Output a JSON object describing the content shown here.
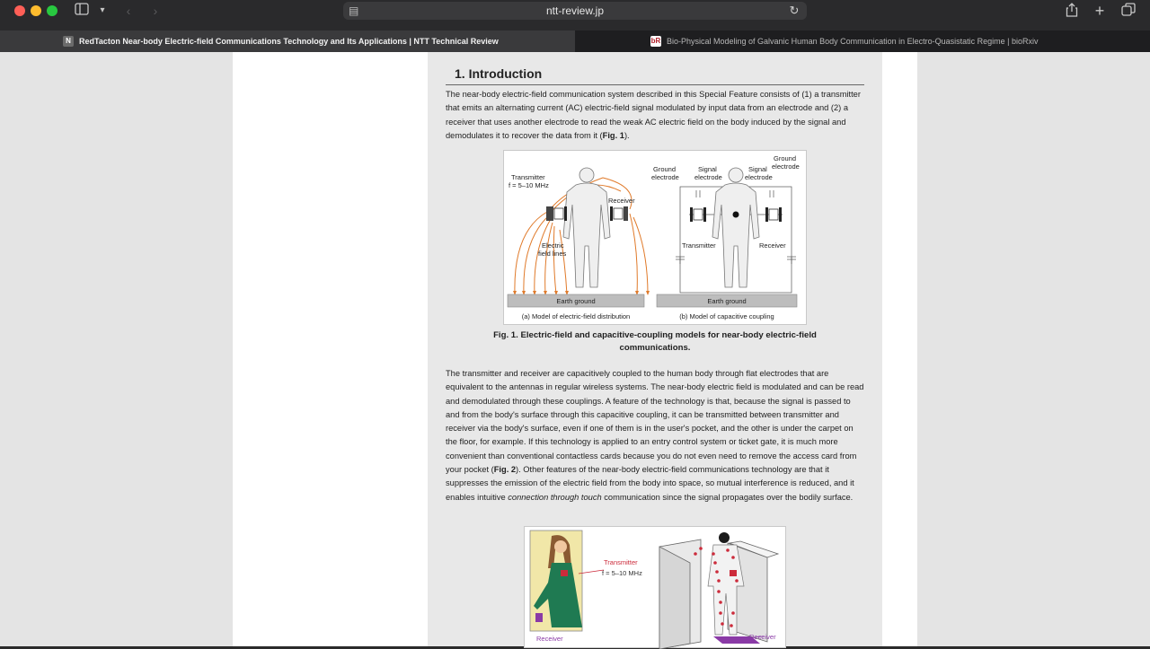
{
  "browser": {
    "address": "ntt-review.jp",
    "tabs": [
      {
        "favicon": "N",
        "title": "RedTacton Near-body Electric-field Communications Technology and Its Applications | NTT Technical Review",
        "active": true
      },
      {
        "favicon": "bR",
        "title": "Bio-Physical Modeling of Galvanic Human Body Communication in Electro-Quasistatic Regime | bioRxiv",
        "active": false
      }
    ],
    "icons": {
      "sidebar": "sidebar-icon",
      "back": "chevron-left-icon",
      "forward": "chevron-right-icon",
      "reload": "reload-icon",
      "share": "share-icon",
      "new_tab": "plus-icon",
      "tab_overview": "tab-overview-icon"
    }
  },
  "article": {
    "section_title": "1. Introduction",
    "para1": [
      {
        "t": "The near-body electric-field communication system described in this Special Feature consists of (1) a transmitter that emits an alternating current (AC) electric-field signal modulated by input data from an electrode and (2) a receiver that uses another electrode to read the weak AC electric field on the body induced by the signal and demodulates it to recover the data from it ("
      },
      {
        "t": "Fig. 1",
        "b": true
      },
      {
        "t": ")."
      }
    ],
    "fig1": {
      "panel_a": {
        "transmitter": "Transmitter",
        "freq": "f = 5–10 MHz",
        "receiver": "Receiver",
        "field_lines_1": "Electric",
        "field_lines_2": "field lines",
        "ground": "Earth ground",
        "caption": "(a) Model of electric-field distribution"
      },
      "panel_b": {
        "ground_electrode_left_1": "Ground",
        "ground_electrode_left_2": "electrode",
        "signal_electrode_left_1": "Signal",
        "signal_electrode_left_2": "electrode",
        "signal_electrode_right_1": "Signal",
        "signal_electrode_right_2": "electrode",
        "ground_electrode_right_1": "Ground",
        "ground_electrode_right_2": "electrode",
        "transmitter": "Transmitter",
        "receiver": "Receiver",
        "ground": "Earth ground",
        "caption": "(b) Model of capacitive coupling"
      }
    },
    "fig1_caption_1": "Fig. 1. Electric-field and capacitive-coupling models for near-body electric-field",
    "fig1_caption_2": "communications.",
    "para2": [
      {
        "t": "The transmitter and receiver are capacitively coupled to the human body through flat electrodes that are equivalent to the antennas in regular wireless systems. The near-body electric field is modulated and can be read and demodulated through these couplings. A feature of the technology is that, because the signal is passed to and from the body's surface through this capacitive coupling, it can be transmitted between transmitter and receiver via the body's surface, even if one of them is in the user's pocket, and the other is under the carpet on the floor, for example. If this technology is applied to an entry control system or ticket gate, it is much more convenient than conventional contactless cards because you do not even need to remove the access card from your pocket ("
      },
      {
        "t": "Fig. 2",
        "b": true
      },
      {
        "t": "). Other features of the near-body electric-field communications technology are that it suppresses the emission of the electric field from the body into space, so mutual interference is reduced, and it enables intuitive "
      },
      {
        "t": "connection through touch",
        "i": true
      },
      {
        "t": " communication since the signal propagates over the bodily surface."
      }
    ],
    "fig2": {
      "transmitter": "Transmitter",
      "freq": "f = 5–10 MHz",
      "receiver_left": "Receiver",
      "receiver_right": "Receiver"
    }
  },
  "colors": {
    "accent_orange": "#e07a2a",
    "transmitter_red": "#cc2b3b",
    "receiver_purple": "#8a3aa6"
  }
}
